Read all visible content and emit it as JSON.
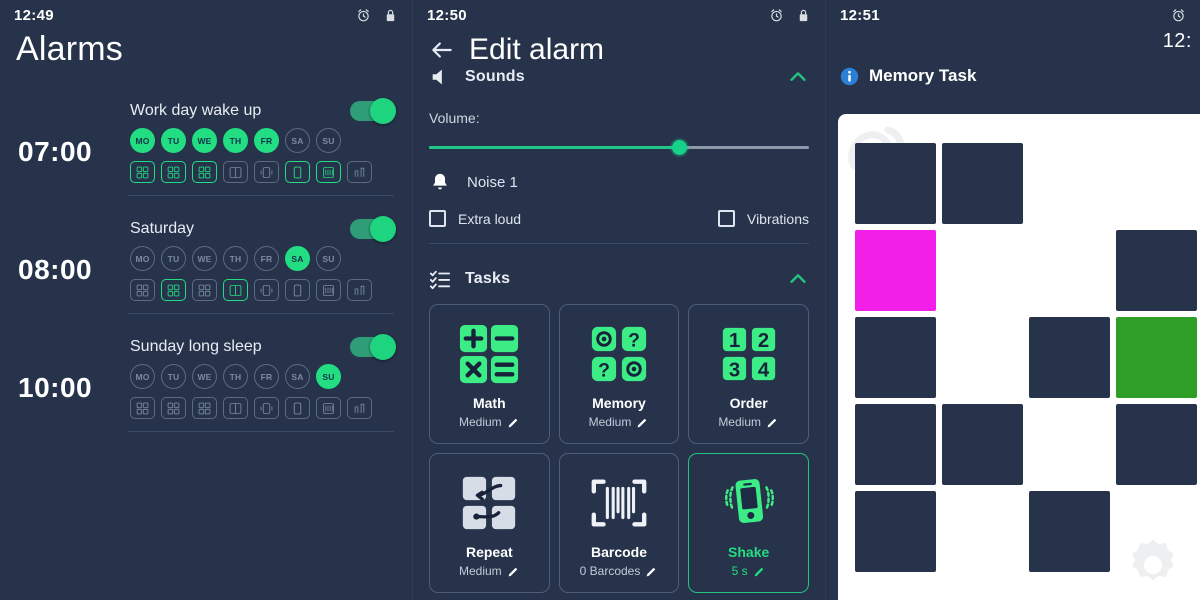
{
  "panels": {
    "alarms": {
      "status_time": "12:49",
      "status_icons": [
        "alarm-clock-icon",
        "lock-icon"
      ],
      "title": "Alarms",
      "day_labels": [
        "MO",
        "TU",
        "WE",
        "TH",
        "FR",
        "SA",
        "SU"
      ],
      "items": [
        {
          "name": "Work day wake up",
          "time": "07:00",
          "enabled": true,
          "days_on": [
            true,
            true,
            true,
            true,
            true,
            false,
            false
          ],
          "tasks_on": [
            true,
            true,
            true,
            false,
            false,
            true,
            true,
            false
          ],
          "task_icons": [
            "math-icon",
            "memory-icon",
            "order-icon",
            "sequence-icon",
            "shake-icon",
            "phone-icon",
            "barcode-icon",
            "steps-icon"
          ]
        },
        {
          "name": "Saturday",
          "time": "08:00",
          "enabled": true,
          "days_on": [
            false,
            false,
            false,
            false,
            false,
            true,
            false
          ],
          "tasks_on": [
            false,
            true,
            false,
            true,
            false,
            false,
            false,
            false
          ],
          "task_icons": [
            "math-icon",
            "memory-icon",
            "order-icon",
            "sequence-icon",
            "shake-icon",
            "phone-icon",
            "barcode-icon",
            "steps-icon"
          ]
        },
        {
          "name": "Sunday long sleep",
          "time": "10:00",
          "enabled": true,
          "days_on": [
            false,
            false,
            false,
            false,
            false,
            false,
            true
          ],
          "tasks_on": [
            false,
            false,
            false,
            false,
            false,
            false,
            false,
            false
          ],
          "task_icons": [
            "math-icon",
            "memory-icon",
            "order-icon",
            "sequence-icon",
            "shake-icon",
            "phone-icon",
            "barcode-icon",
            "steps-icon"
          ]
        }
      ]
    },
    "edit": {
      "status_time": "12:50",
      "status_icons": [
        "alarm-clock-icon",
        "lock-icon"
      ],
      "title": "Edit alarm",
      "back_label": "Back",
      "sounds": {
        "header": "Sounds",
        "volume_label": "Volume:",
        "volume_percent": 66,
        "sound_name": "Noise 1",
        "extra_loud_label": "Extra loud",
        "extra_loud_checked": false,
        "vibrations_label": "Vibrations",
        "vibrations_checked": false
      },
      "tasks": {
        "header": "Tasks",
        "cards": [
          {
            "name": "Math",
            "sub": "Medium",
            "icon": "math-icon",
            "selected": false
          },
          {
            "name": "Memory",
            "sub": "Medium",
            "icon": "memory-icon",
            "selected": false
          },
          {
            "name": "Order",
            "sub": "Medium",
            "icon": "order-icon",
            "selected": false
          },
          {
            "name": "Repeat",
            "sub": "Medium",
            "icon": "repeat-icon",
            "selected": false
          },
          {
            "name": "Barcode",
            "sub": "0 Barcodes",
            "icon": "barcode-icon",
            "selected": false
          },
          {
            "name": "Shake",
            "sub": "5 s",
            "icon": "shake-icon",
            "selected": true
          }
        ]
      }
    },
    "memory": {
      "status_time": "12:51",
      "status_icons": [
        "alarm-clock-icon"
      ],
      "clock": "12:",
      "title": "Memory Task",
      "grid": {
        "columns": 4,
        "rows": 5,
        "cells": [
          "dark",
          "dark",
          "empty",
          "empty",
          "magenta",
          "empty",
          "empty",
          "dark",
          "dark",
          "empty",
          "dark",
          "green",
          "dark",
          "dark",
          "empty",
          "dark",
          "dark",
          "empty",
          "dark",
          "empty"
        ]
      }
    }
  },
  "colors": {
    "background": "#26334b",
    "accent_green": "#22dd82",
    "tile_dark": "#26334b",
    "tile_magenta": "#f11fe8",
    "tile_green": "#2e9e27",
    "board_white": "#ffffff",
    "muted": "#7d8aa0"
  }
}
